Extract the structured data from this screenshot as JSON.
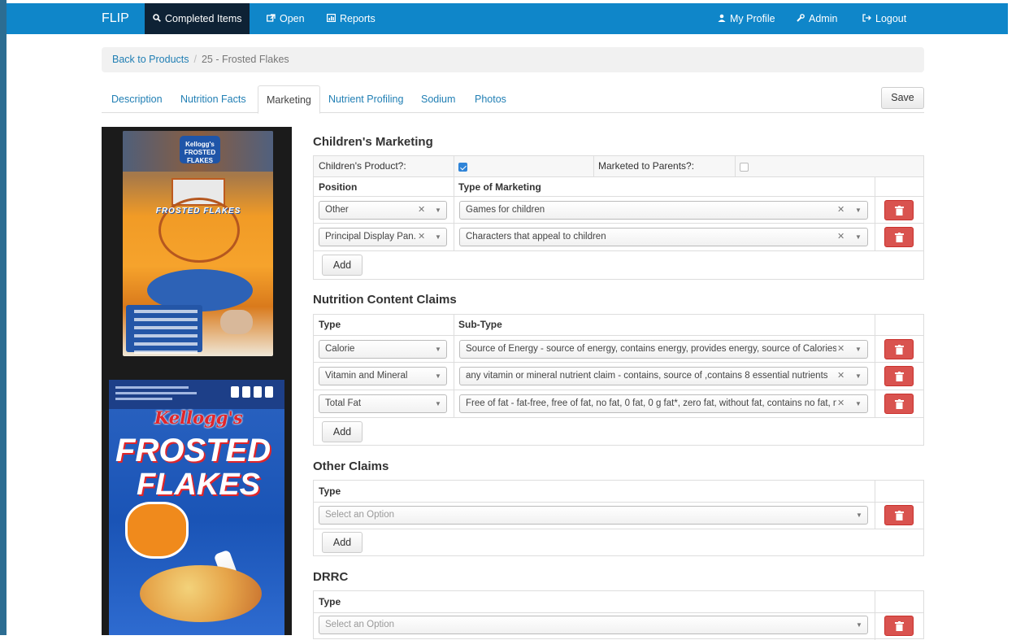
{
  "navbar": {
    "brand": "FLIP",
    "items": [
      {
        "label": "Completed Items",
        "icon": "search-icon"
      },
      {
        "label": "Open",
        "icon": "external-link-icon"
      },
      {
        "label": "Reports",
        "icon": "chart-icon"
      }
    ],
    "right_items": [
      {
        "label": "My Profile",
        "icon": "user-icon"
      },
      {
        "label": "Admin",
        "icon": "wrench-icon"
      },
      {
        "label": "Logout",
        "icon": "logout-icon"
      }
    ]
  },
  "breadcrumb": {
    "back_label": "Back to Products",
    "separator": "/",
    "current": "25 - Frosted Flakes"
  },
  "tabs": [
    "Description",
    "Nutrition Facts",
    "Marketing",
    "Nutrient Profiling",
    "Sodium",
    "Photos"
  ],
  "active_tab": "Marketing",
  "save_label": "Save",
  "product_photos": {
    "photo1_text": "FROSTED FLAKES",
    "photo1_logo": "Kellogg's FROSTED FLAKES",
    "photo2_kelloggs": "Kellogg's",
    "photo2_line1": "FROSTED",
    "photo2_line2": "FLAKES"
  },
  "childrens_marketing": {
    "title": "Children's Marketing",
    "childrens_product_label": "Children's Product?:",
    "childrens_product_checked": true,
    "marketed_to_parents_label": "Marketed to Parents?:",
    "marketed_to_parents_checked": false,
    "headers": {
      "position": "Position",
      "type": "Type of Marketing"
    },
    "rows": [
      {
        "position": "Other",
        "type": "Games for children"
      },
      {
        "position": "Principal Display Pan...",
        "type": "Characters that appeal to children"
      }
    ],
    "add_label": "Add"
  },
  "nutrition_claims": {
    "title": "Nutrition Content Claims",
    "headers": {
      "type": "Type",
      "subtype": "Sub-Type"
    },
    "rows": [
      {
        "type": "Calorie",
        "subtype": "Source of Energy - source of energy, contains energy, provides energy, source of Calories, ..."
      },
      {
        "type": "Vitamin and Mineral",
        "subtype": "any vitamin or mineral nutrient claim - contains, source of ,contains 8 essential nutrients"
      },
      {
        "type": "Total Fat",
        "subtype": "Free of fat - fat-free, free of fat, no fat, 0 fat, 0 g fat*, zero fat, without fat, contains no fat, n..."
      }
    ],
    "add_label": "Add"
  },
  "other_claims": {
    "title": "Other Claims",
    "header": "Type",
    "placeholder": "Select an Option",
    "add_label": "Add"
  },
  "drrc": {
    "title": "DRRC",
    "header": "Type",
    "placeholder": "Select an Option"
  }
}
